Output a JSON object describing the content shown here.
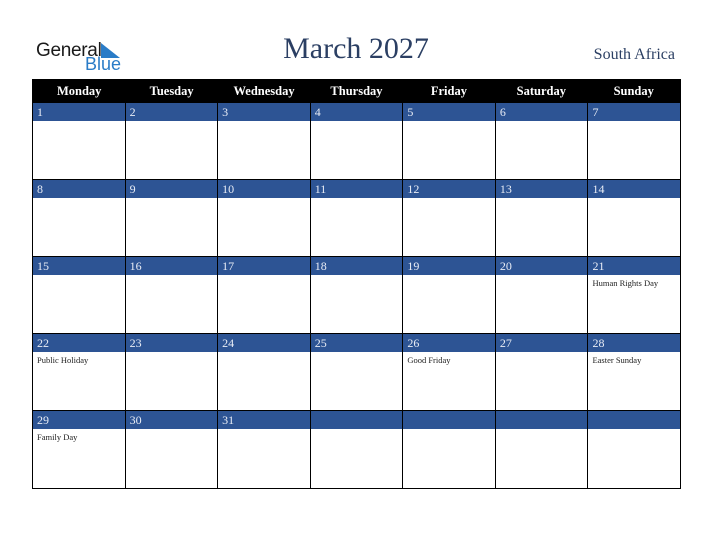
{
  "logo": {
    "word1": "General",
    "word2": "Blue"
  },
  "title": "March 2027",
  "country": "South Africa",
  "colors": {
    "band": "#2d5494",
    "header": "#000000",
    "title": "#2b3f63",
    "logo_blue": "#2a7cc7"
  },
  "weekdays": [
    "Monday",
    "Tuesday",
    "Wednesday",
    "Thursday",
    "Friday",
    "Saturday",
    "Sunday"
  ],
  "weeks": [
    [
      {
        "day": "1",
        "holiday": ""
      },
      {
        "day": "2",
        "holiday": ""
      },
      {
        "day": "3",
        "holiday": ""
      },
      {
        "day": "4",
        "holiday": ""
      },
      {
        "day": "5",
        "holiday": ""
      },
      {
        "day": "6",
        "holiday": ""
      },
      {
        "day": "7",
        "holiday": ""
      }
    ],
    [
      {
        "day": "8",
        "holiday": ""
      },
      {
        "day": "9",
        "holiday": ""
      },
      {
        "day": "10",
        "holiday": ""
      },
      {
        "day": "11",
        "holiday": ""
      },
      {
        "day": "12",
        "holiday": ""
      },
      {
        "day": "13",
        "holiday": ""
      },
      {
        "day": "14",
        "holiday": ""
      }
    ],
    [
      {
        "day": "15",
        "holiday": ""
      },
      {
        "day": "16",
        "holiday": ""
      },
      {
        "day": "17",
        "holiday": ""
      },
      {
        "day": "18",
        "holiday": ""
      },
      {
        "day": "19",
        "holiday": ""
      },
      {
        "day": "20",
        "holiday": ""
      },
      {
        "day": "21",
        "holiday": "Human Rights Day"
      }
    ],
    [
      {
        "day": "22",
        "holiday": "Public Holiday"
      },
      {
        "day": "23",
        "holiday": ""
      },
      {
        "day": "24",
        "holiday": ""
      },
      {
        "day": "25",
        "holiday": ""
      },
      {
        "day": "26",
        "holiday": "Good Friday"
      },
      {
        "day": "27",
        "holiday": ""
      },
      {
        "day": "28",
        "holiday": "Easter Sunday"
      }
    ],
    [
      {
        "day": "29",
        "holiday": "Family Day"
      },
      {
        "day": "30",
        "holiday": ""
      },
      {
        "day": "31",
        "holiday": ""
      },
      {
        "day": "",
        "holiday": ""
      },
      {
        "day": "",
        "holiday": ""
      },
      {
        "day": "",
        "holiday": ""
      },
      {
        "day": "",
        "holiday": ""
      }
    ]
  ]
}
